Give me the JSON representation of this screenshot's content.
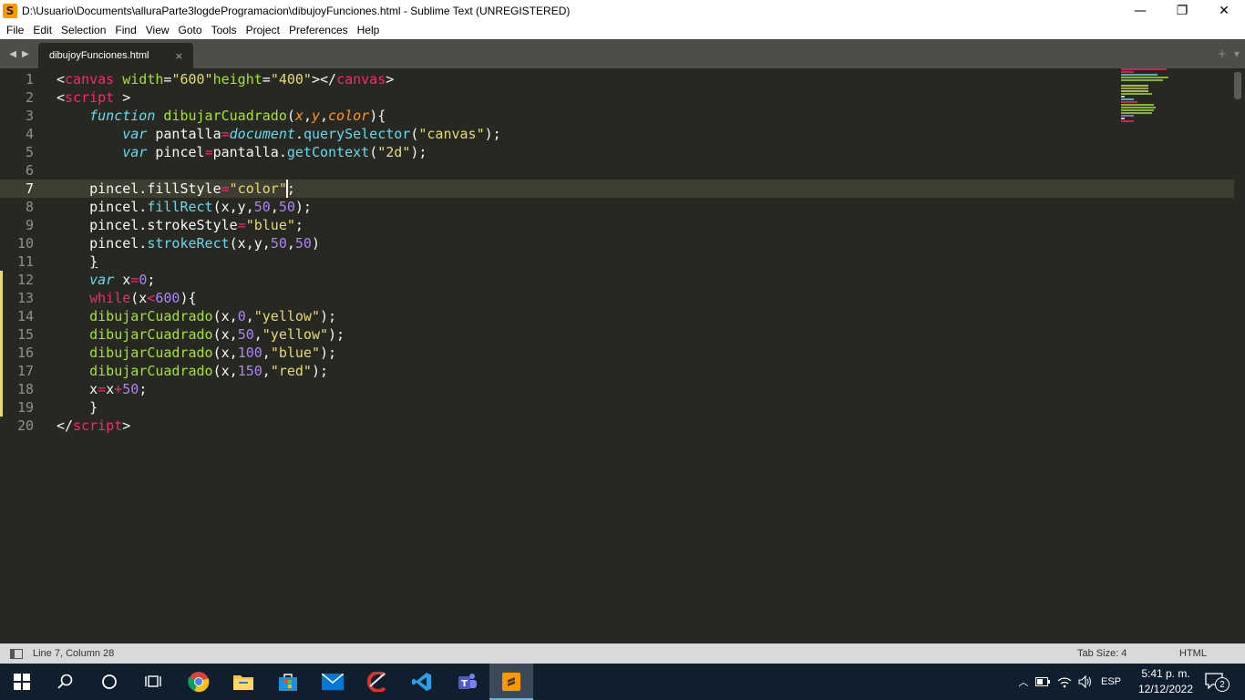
{
  "window": {
    "title": "D:\\Usuario\\Documents\\alluraParte3logdeProgramacion\\dibujoyFunciones.html - Sublime Text (UNREGISTERED)",
    "app_icon_glyph": "S",
    "controls": {
      "minimize": "—",
      "restore": "❐",
      "close": "✕"
    }
  },
  "menu": [
    "File",
    "Edit",
    "Selection",
    "Find",
    "View",
    "Goto",
    "Tools",
    "Project",
    "Preferences",
    "Help"
  ],
  "tabs": {
    "nav_left": "◀",
    "nav_right": "▶",
    "active_tab": "dibujoyFunciones.html",
    "close_glyph": "×",
    "new_tab_glyph": "+",
    "overflow_glyph": "▾"
  },
  "editor": {
    "active_line": 7,
    "modified_lines": [
      12,
      13,
      14,
      15,
      16,
      17,
      18,
      19
    ],
    "line_numbers": [
      "1",
      "2",
      "3",
      "4",
      "5",
      "6",
      "7",
      "8",
      "9",
      "10",
      "11",
      "12",
      "13",
      "14",
      "15",
      "16",
      "17",
      "18",
      "19",
      "20"
    ],
    "lines": [
      [
        [
          "pun",
          "<"
        ],
        [
          "tag",
          "canvas"
        ],
        [
          "pun",
          " "
        ],
        [
          "att",
          "width"
        ],
        [
          "pun",
          "="
        ],
        [
          "str",
          "\"600\""
        ],
        [
          "att",
          "height"
        ],
        [
          "pun",
          "="
        ],
        [
          "str",
          "\"400\""
        ],
        [
          "pun",
          "></"
        ],
        [
          "tag",
          "canvas"
        ],
        [
          "pun",
          ">"
        ]
      ],
      [
        [
          "pun",
          "<"
        ],
        [
          "tag",
          "script"
        ],
        [
          "pun",
          " >"
        ]
      ],
      [
        [
          "plain",
          "    "
        ],
        [
          "kwi",
          "function"
        ],
        [
          "plain",
          " "
        ],
        [
          "fn",
          "dibujarCuadrado"
        ],
        [
          "pun",
          "("
        ],
        [
          "par",
          "x"
        ],
        [
          "pun",
          ","
        ],
        [
          "par",
          "y"
        ],
        [
          "pun",
          ","
        ],
        [
          "par",
          "color"
        ],
        [
          "pun",
          "){"
        ]
      ],
      [
        [
          "plain",
          "        "
        ],
        [
          "kwi",
          "var"
        ],
        [
          "plain",
          " pantalla"
        ],
        [
          "op",
          "="
        ],
        [
          "bi",
          "document"
        ],
        [
          "pun",
          "."
        ],
        [
          "fnc",
          "querySelector"
        ],
        [
          "pun",
          "("
        ],
        [
          "str",
          "\"canvas\""
        ],
        [
          "pun",
          ");"
        ]
      ],
      [
        [
          "plain",
          "        "
        ],
        [
          "kwi",
          "var"
        ],
        [
          "plain",
          " pincel"
        ],
        [
          "op",
          "="
        ],
        [
          "plain",
          "pantalla"
        ],
        [
          "pun",
          "."
        ],
        [
          "fnc",
          "getContext"
        ],
        [
          "pun",
          "("
        ],
        [
          "str",
          "\"2d\""
        ],
        [
          "pun",
          ");"
        ]
      ],
      [],
      [
        [
          "plain",
          "    pincel.fillStyle"
        ],
        [
          "op",
          "="
        ],
        [
          "str",
          "\"color\""
        ],
        [
          "pun",
          ";"
        ]
      ],
      [
        [
          "plain",
          "    pincel."
        ],
        [
          "fnc",
          "fillRect"
        ],
        [
          "pun",
          "(x,y,"
        ],
        [
          "num",
          "50"
        ],
        [
          "pun",
          ","
        ],
        [
          "num",
          "50"
        ],
        [
          "pun",
          ");"
        ]
      ],
      [
        [
          "plain",
          "    pincel.strokeStyle"
        ],
        [
          "op",
          "="
        ],
        [
          "str",
          "\"blue\""
        ],
        [
          "pun",
          ";"
        ]
      ],
      [
        [
          "plain",
          "    pincel."
        ],
        [
          "fnc",
          "strokeRect"
        ],
        [
          "pun",
          "(x,y,"
        ],
        [
          "num",
          "50"
        ],
        [
          "pun",
          ","
        ],
        [
          "num",
          "50"
        ],
        [
          "pun",
          ")"
        ]
      ],
      [
        [
          "plain",
          "    "
        ],
        [
          "ul",
          "}"
        ]
      ],
      [
        [
          "plain",
          "    "
        ],
        [
          "kwi",
          "var"
        ],
        [
          "plain",
          " x"
        ],
        [
          "op",
          "="
        ],
        [
          "num",
          "0"
        ],
        [
          "pun",
          ";"
        ]
      ],
      [
        [
          "plain",
          "    "
        ],
        [
          "kw",
          "while"
        ],
        [
          "pun",
          "(x"
        ],
        [
          "op",
          "<"
        ],
        [
          "num",
          "600"
        ],
        [
          "pun",
          "){"
        ]
      ],
      [
        [
          "plain",
          "    "
        ],
        [
          "fn",
          "dibujarCuadrado"
        ],
        [
          "pun",
          "(x,"
        ],
        [
          "num",
          "0"
        ],
        [
          "pun",
          ","
        ],
        [
          "str",
          "\"yellow\""
        ],
        [
          "pun",
          ");"
        ]
      ],
      [
        [
          "plain",
          "    "
        ],
        [
          "fn",
          "dibujarCuadrado"
        ],
        [
          "pun",
          "(x,"
        ],
        [
          "num",
          "50"
        ],
        [
          "pun",
          ","
        ],
        [
          "str",
          "\"yellow\""
        ],
        [
          "pun",
          ");"
        ]
      ],
      [
        [
          "plain",
          "    "
        ],
        [
          "fn",
          "dibujarCuadrado"
        ],
        [
          "pun",
          "(x,"
        ],
        [
          "num",
          "100"
        ],
        [
          "pun",
          ","
        ],
        [
          "str",
          "\"blue\""
        ],
        [
          "pun",
          ");"
        ]
      ],
      [
        [
          "plain",
          "    "
        ],
        [
          "fn",
          "dibujarCuadrado"
        ],
        [
          "pun",
          "(x,"
        ],
        [
          "num",
          "150"
        ],
        [
          "pun",
          ","
        ],
        [
          "str",
          "\"red\""
        ],
        [
          "pun",
          ");"
        ]
      ],
      [
        [
          "plain",
          "    x"
        ],
        [
          "op",
          "="
        ],
        [
          "plain",
          "x"
        ],
        [
          "op",
          "+"
        ],
        [
          "num",
          "50"
        ],
        [
          "pun",
          ";"
        ]
      ],
      [
        [
          "plain",
          "    }"
        ]
      ],
      [
        [
          "pun",
          "</"
        ],
        [
          "tag",
          "script"
        ],
        [
          "pun",
          ">"
        ]
      ]
    ]
  },
  "status": {
    "position": "Line 7, Column 28",
    "tab_size": "Tab Size: 4",
    "syntax": "HTML"
  },
  "taskbar": {
    "apps": [
      "start-icon",
      "search-icon",
      "cortana-icon",
      "task-view-icon",
      "chrome-icon",
      "file-explorer-icon",
      "store-icon",
      "mail-icon",
      "ccleaner-icon",
      "vscode-icon",
      "teams-icon",
      "sublime-text-icon"
    ],
    "language": "ESP",
    "time": "5:41 p. m.",
    "date": "12/12/2022",
    "notifications": "2"
  },
  "colors": {
    "editor_bg": "#272822",
    "tabbar_bg": "#4d4e48",
    "taskbar_bg": "#0f1f2d",
    "modified_marker": "#e6db74"
  }
}
